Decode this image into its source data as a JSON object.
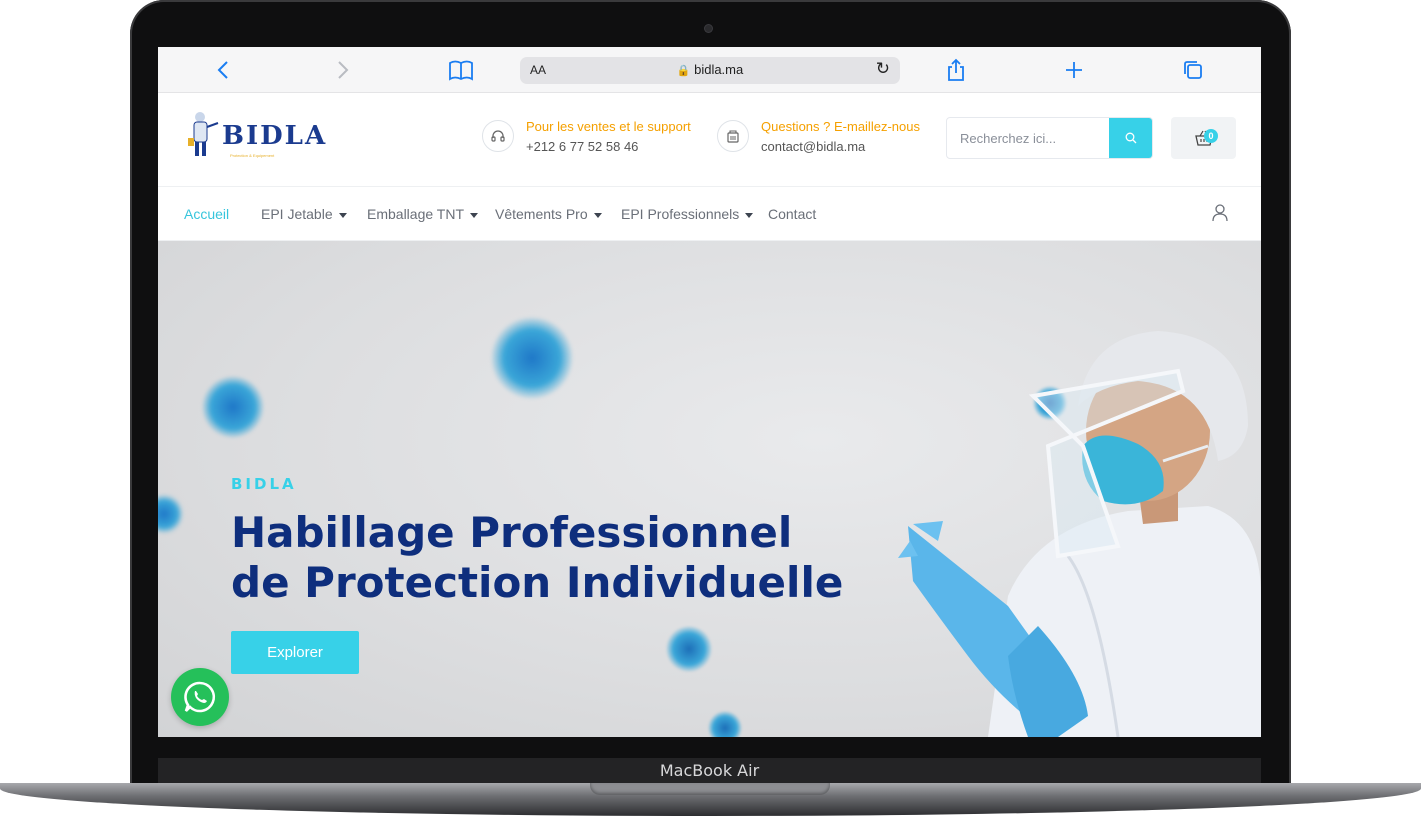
{
  "device": {
    "label": "MacBook Air"
  },
  "browser": {
    "aa_label": "AA",
    "url": "bidla.ma",
    "accent": "#1a7df2"
  },
  "site": {
    "logo": {
      "name": "BIDLA",
      "tagline": "Protection & Equipement"
    },
    "contacts": [
      {
        "title": "Pour les ventes et le support",
        "value": "+212 6 77 52 58 46",
        "icon": "headset-icon"
      },
      {
        "title": "Questions ? E-maillez-nous",
        "value": "contact@bidla.ma",
        "icon": "mail-icon"
      }
    ],
    "search": {
      "placeholder": "Recherchez ici..."
    },
    "cart": {
      "count": "0"
    },
    "nav": [
      {
        "label": "Accueil",
        "active": true
      },
      {
        "label": "EPI Jetable",
        "dropdown": true
      },
      {
        "label": "Emballage TNT",
        "dropdown": true
      },
      {
        "label": "Vêtements Pro",
        "dropdown": true
      },
      {
        "label": "EPI Professionnels",
        "dropdown": true
      },
      {
        "label": "Contact"
      }
    ],
    "hero": {
      "brand": "BIDLA",
      "title_line1": "Habillage Professionnel",
      "title_line2": "de Protection Individuelle",
      "button": "Explorer"
    },
    "colors": {
      "accent": "#37d1e8",
      "title": "#0e2e7d",
      "support": "#f5a000",
      "whatsapp": "#25c05a"
    }
  }
}
